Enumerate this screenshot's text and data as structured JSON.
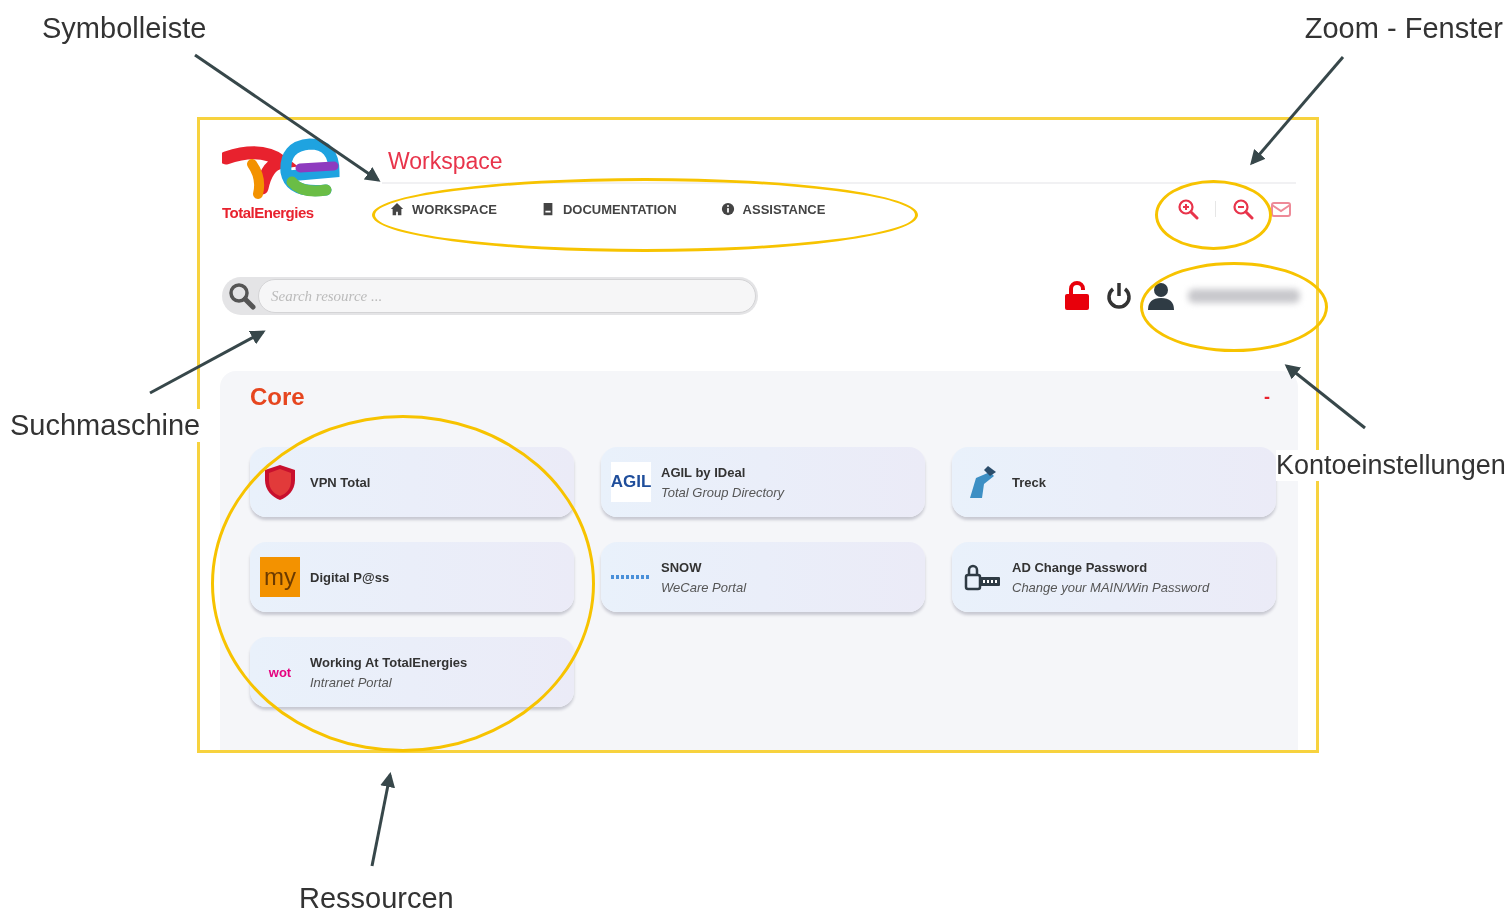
{
  "annotations": [
    {
      "label": "Symbolleiste",
      "kind": "toolbar"
    },
    {
      "label": "Zoom - Fenster",
      "kind": "zoom"
    },
    {
      "label": "Suchmaschine",
      "kind": "search"
    },
    {
      "label": "Kontoeinstellungen",
      "kind": "account"
    },
    {
      "label": "Ressourcen",
      "kind": "resources"
    }
  ],
  "header": {
    "brand": "TotalEnergies",
    "title": "Workspace",
    "nav": [
      {
        "label": "WORKSPACE",
        "kind": "home"
      },
      {
        "label": "DOCUMENTATION",
        "kind": "book"
      },
      {
        "label": "ASSISTANCE",
        "kind": "info"
      }
    ]
  },
  "search": {
    "placeholder": "Search resource ..."
  },
  "section": {
    "title": "Core",
    "toggle": "-",
    "resources": [
      {
        "title": "VPN Total",
        "kind": "shield"
      },
      {
        "title": "AGIL by IDeal",
        "subtitle": "Total Group Directory",
        "kind": "agil",
        "logo": "AGIL"
      },
      {
        "title": "Treck",
        "kind": "treck"
      },
      {
        "title": "Digital P@ss",
        "kind": "my",
        "logo": "my"
      },
      {
        "title": "SNOW",
        "subtitle": "WeCare Portal",
        "kind": "snow"
      },
      {
        "title": "AD Change Password",
        "subtitle": "Change your MAIN/Win Password",
        "kind": "password"
      },
      {
        "title": "Working At TotalEnergies",
        "subtitle": "Intranet Portal",
        "kind": "wot",
        "logo": "wot"
      }
    ]
  }
}
